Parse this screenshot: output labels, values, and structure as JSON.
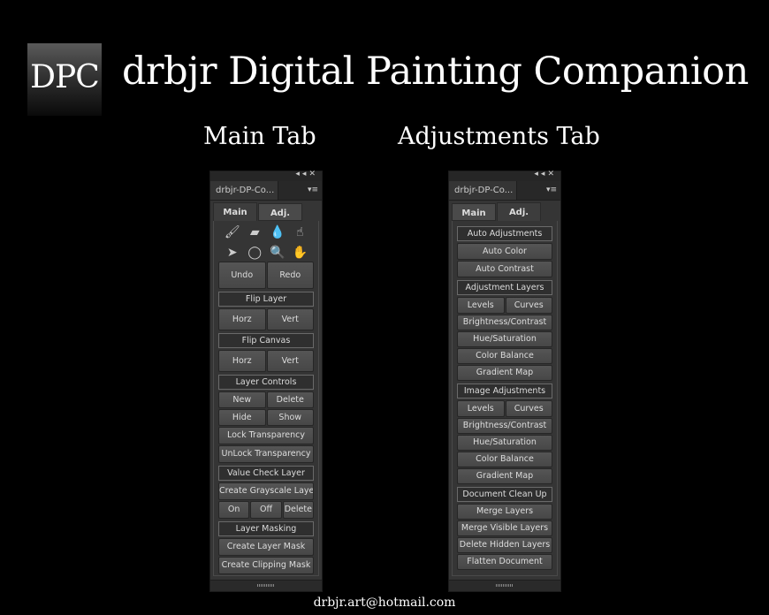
{
  "logo": {
    "text": "DPC"
  },
  "title": "drbjr Digital Painting Companion",
  "captions": {
    "main": "Main Tab",
    "adjust": "Adjustments Tab"
  },
  "email": "drbjr.art@hotmail.com",
  "panel_common": {
    "collapse": "◂◂",
    "close": "✕",
    "menu": "▾≡",
    "panel_tab": "drbjr-DP-Co...",
    "tab_main": "Main",
    "tab_adj": "Adj."
  },
  "main_panel": {
    "tools": [
      {
        "icon": "brush-icon",
        "glyph": "🖌"
      },
      {
        "icon": "eraser-icon",
        "glyph": "▰"
      },
      {
        "icon": "mixer-brush-icon",
        "glyph": "💧"
      },
      {
        "icon": "smudge-icon",
        "glyph": "☝"
      },
      {
        "icon": "move-icon",
        "glyph": "➤"
      },
      {
        "icon": "lasso-icon",
        "glyph": "◯"
      },
      {
        "icon": "zoom-icon",
        "glyph": "🔍"
      },
      {
        "icon": "hand-icon",
        "glyph": "✋"
      }
    ],
    "rows": [
      {
        "h": 31,
        "items": [
          {
            "t": "b",
            "label": "Undo"
          },
          {
            "t": "b",
            "label": "Redo"
          }
        ]
      },
      {
        "h": 17,
        "items": [
          {
            "t": "h",
            "label": "Flip Layer"
          }
        ]
      },
      {
        "h": 25,
        "items": [
          {
            "t": "b",
            "label": "Horz"
          },
          {
            "t": "b",
            "label": "Vert"
          }
        ]
      },
      {
        "h": 17,
        "items": [
          {
            "t": "h",
            "label": "Flip Canvas"
          }
        ]
      },
      {
        "h": 25,
        "items": [
          {
            "t": "b",
            "label": "Horz"
          },
          {
            "t": "b",
            "label": "Vert"
          }
        ]
      },
      {
        "h": 17,
        "items": [
          {
            "t": "h",
            "label": "Layer Controls"
          }
        ]
      },
      {
        "h": 19,
        "items": [
          {
            "t": "b",
            "label": "New"
          },
          {
            "t": "b",
            "label": "Delete"
          }
        ]
      },
      {
        "h": 19,
        "items": [
          {
            "t": "b",
            "label": "Hide"
          },
          {
            "t": "b",
            "label": "Show"
          }
        ]
      },
      {
        "h": 20,
        "items": [
          {
            "t": "b",
            "label": "Lock Transparency"
          }
        ]
      },
      {
        "h": 20,
        "items": [
          {
            "t": "b",
            "label": "UnLock Transparency"
          }
        ]
      },
      {
        "h": 17,
        "items": [
          {
            "t": "h",
            "label": "Value Check Layer"
          }
        ]
      },
      {
        "h": 20,
        "items": [
          {
            "t": "b",
            "label": "Create Grayscale Layer"
          }
        ]
      },
      {
        "h": 20,
        "items": [
          {
            "t": "b",
            "label": "On"
          },
          {
            "t": "b",
            "label": "Off"
          },
          {
            "t": "b",
            "label": "Delete"
          }
        ]
      },
      {
        "h": 17,
        "items": [
          {
            "t": "h",
            "label": "Layer Masking"
          }
        ]
      },
      {
        "h": 20,
        "items": [
          {
            "t": "b",
            "label": "Create Layer Mask"
          }
        ]
      },
      {
        "h": 20,
        "items": [
          {
            "t": "b",
            "label": "Create Clipping Mask"
          }
        ]
      }
    ]
  },
  "adj_panel": {
    "rows": [
      {
        "h": 17,
        "items": [
          {
            "t": "h",
            "label": "Auto Adjustments"
          }
        ]
      },
      {
        "h": 19,
        "items": [
          {
            "t": "b",
            "label": "Auto Color"
          }
        ]
      },
      {
        "h": 19,
        "items": [
          {
            "t": "b",
            "label": "Auto Contrast"
          }
        ]
      },
      {
        "h": 17,
        "items": [
          {
            "t": "h",
            "label": "Adjustment Layers"
          }
        ]
      },
      {
        "h": 19,
        "items": [
          {
            "t": "b",
            "label": "Levels"
          },
          {
            "t": "b",
            "label": "Curves"
          }
        ]
      },
      {
        "h": 18,
        "items": [
          {
            "t": "b",
            "label": "Brightness/Contrast"
          }
        ]
      },
      {
        "h": 18,
        "items": [
          {
            "t": "b",
            "label": "Hue/Saturation"
          }
        ]
      },
      {
        "h": 18,
        "items": [
          {
            "t": "b",
            "label": "Color Balance"
          }
        ]
      },
      {
        "h": 18,
        "items": [
          {
            "t": "b",
            "label": "Gradient Map"
          }
        ]
      },
      {
        "h": 17,
        "items": [
          {
            "t": "h",
            "label": "Image Adjustments"
          }
        ]
      },
      {
        "h": 19,
        "items": [
          {
            "t": "b",
            "label": "Levels"
          },
          {
            "t": "b",
            "label": "Curves"
          }
        ]
      },
      {
        "h": 18,
        "items": [
          {
            "t": "b",
            "label": "Brightness/Contrast"
          }
        ]
      },
      {
        "h": 18,
        "items": [
          {
            "t": "b",
            "label": "Hue/Saturation"
          }
        ]
      },
      {
        "h": 18,
        "items": [
          {
            "t": "b",
            "label": "Color Balance"
          }
        ]
      },
      {
        "h": 18,
        "items": [
          {
            "t": "b",
            "label": "Gradient Map"
          }
        ]
      },
      {
        "h": 17,
        "items": [
          {
            "t": "h",
            "label": "Document Clean Up"
          }
        ]
      },
      {
        "h": 18,
        "items": [
          {
            "t": "b",
            "label": "Merge Layers"
          }
        ]
      },
      {
        "h": 18,
        "items": [
          {
            "t": "b",
            "label": "Merge Visible Layers"
          }
        ]
      },
      {
        "h": 18,
        "items": [
          {
            "t": "b",
            "label": "Delete Hidden Layers"
          }
        ]
      },
      {
        "h": 18,
        "items": [
          {
            "t": "b",
            "label": "Flatten Document"
          }
        ]
      }
    ]
  }
}
